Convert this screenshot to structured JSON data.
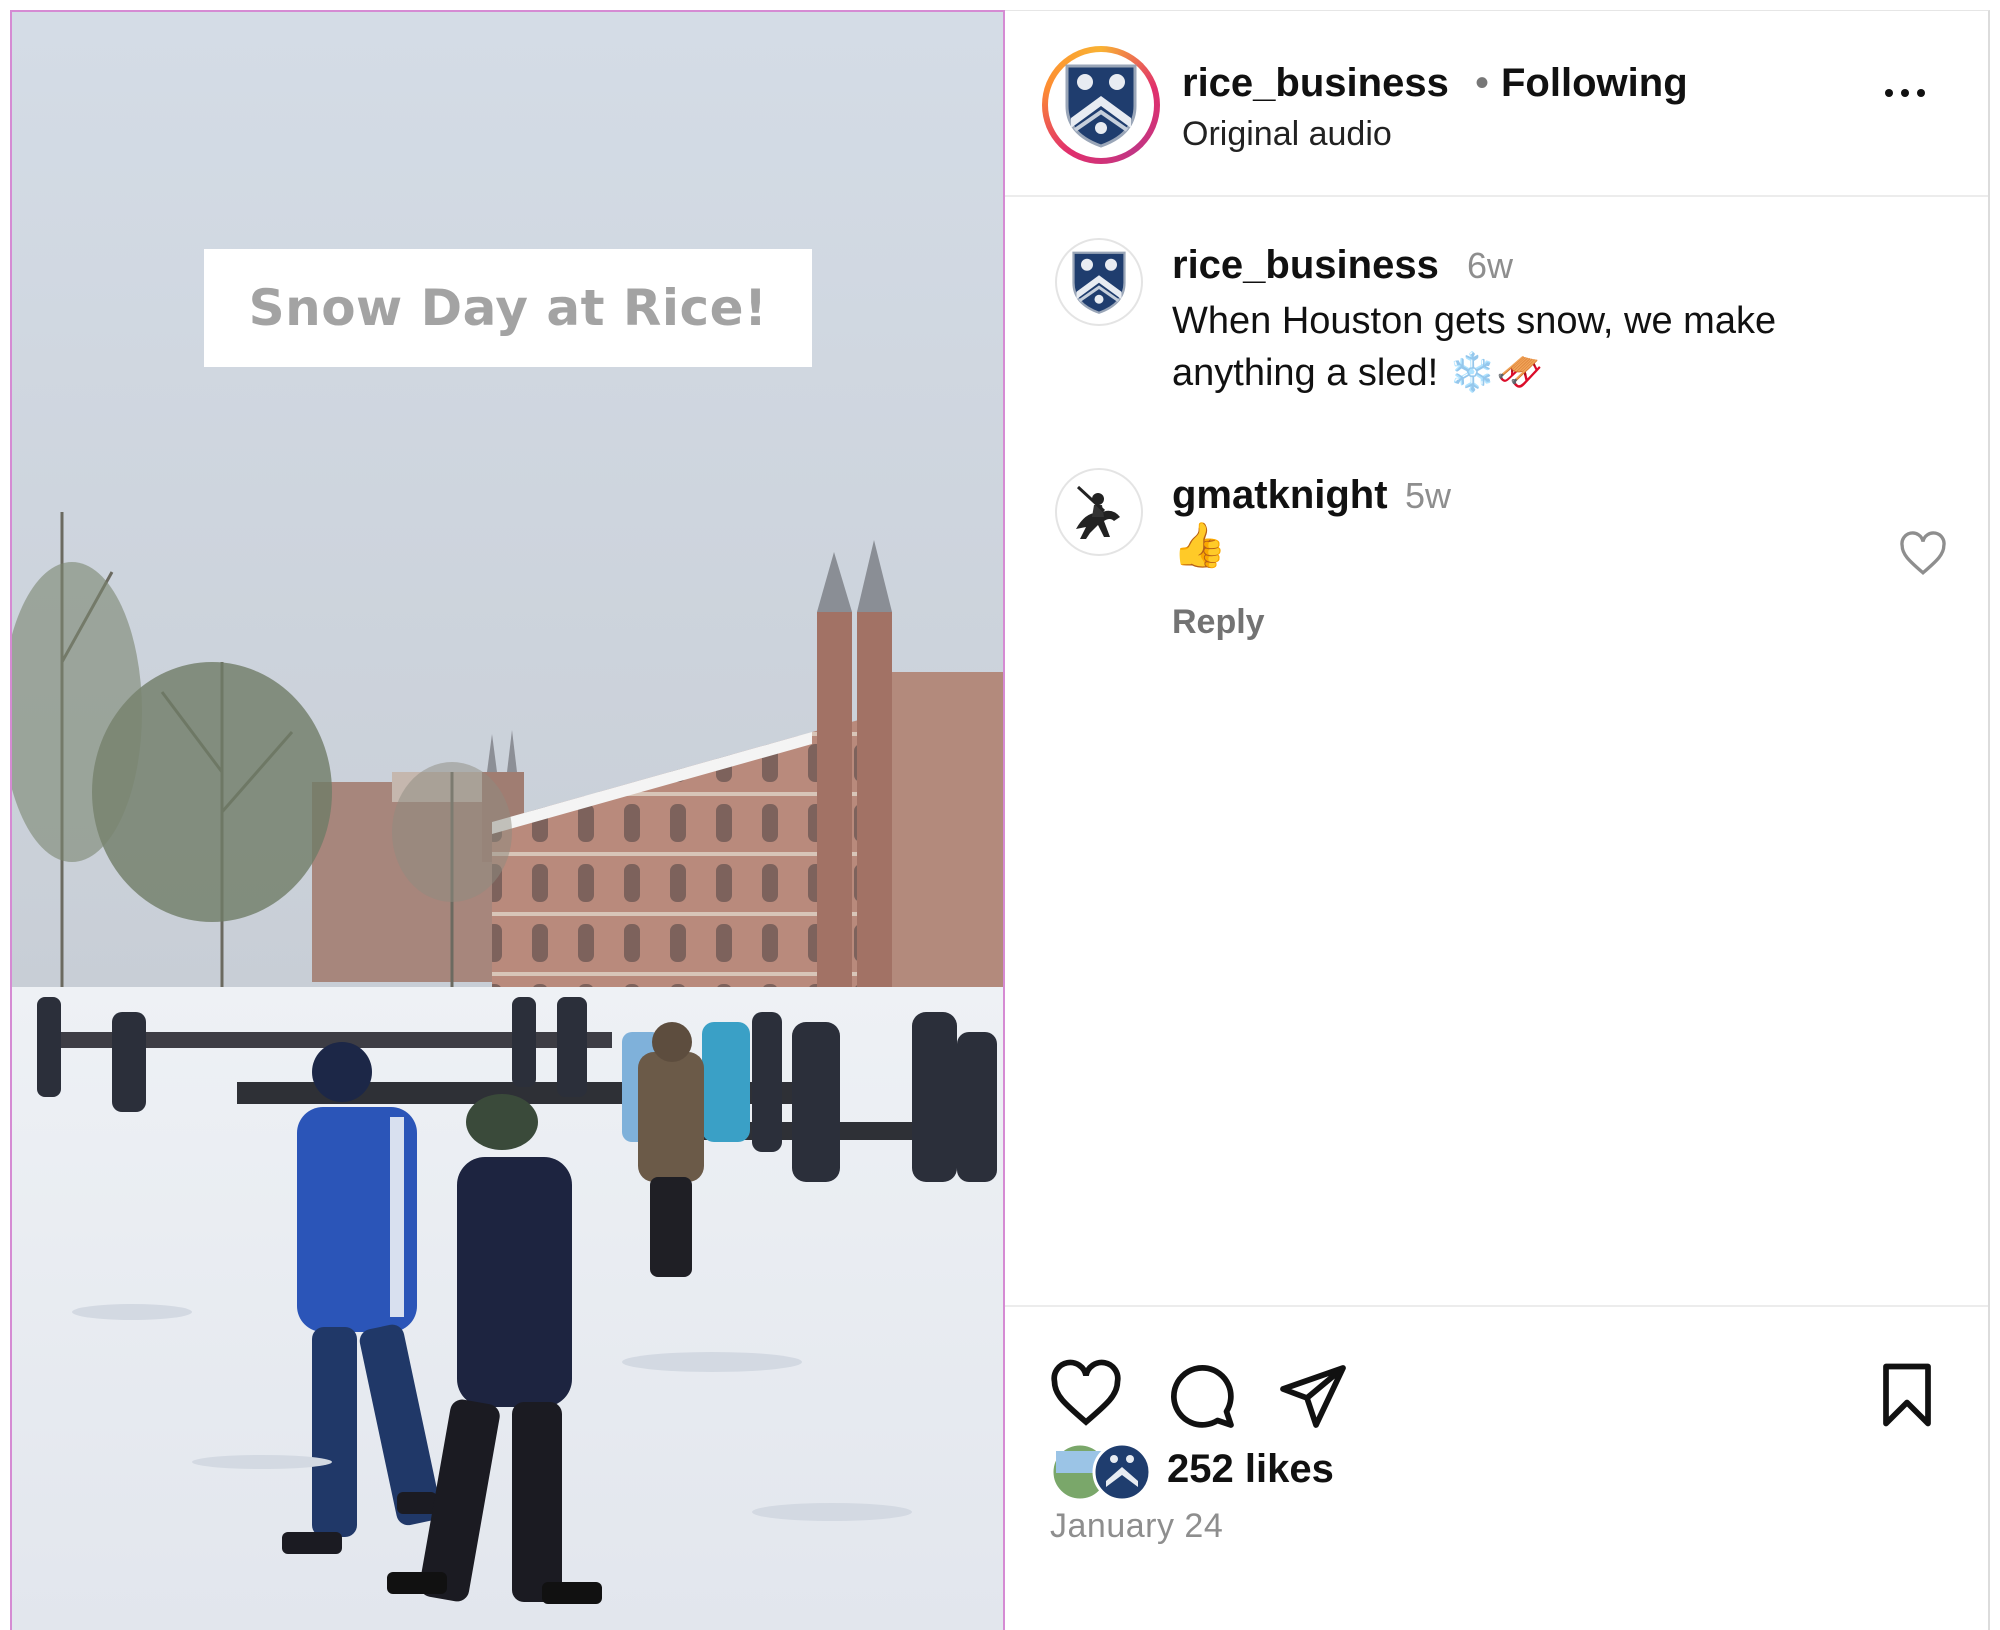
{
  "media": {
    "overlay_text": "Snow Day at Rice!"
  },
  "header": {
    "username": "rice_business",
    "separator": "•",
    "follow_status": "Following",
    "audio_label": "Original audio",
    "avatar_icon": "rice-shield-icon",
    "more_icon": "more-options-icon"
  },
  "caption": {
    "username": "rice_business",
    "time": "6w",
    "text": "When Houston gets snow, we make anything a sled! ❄️🛷"
  },
  "comments": [
    {
      "username": "gmatknight",
      "time": "5w",
      "text": "👍",
      "reply_label": "Reply",
      "like_icon": "heart-outline-icon"
    }
  ],
  "actions": {
    "like_icon": "heart-icon",
    "comment_icon": "comment-icon",
    "share_icon": "share-icon",
    "save_icon": "bookmark-icon"
  },
  "likes": {
    "text": "252 likes"
  },
  "date": "January 24",
  "colors": {
    "ring_gradient": [
      "#f9b233",
      "#e1306c",
      "#c13584"
    ],
    "secondary_text": "#8e8e8e",
    "shield_blue": "#1f3d6e"
  }
}
